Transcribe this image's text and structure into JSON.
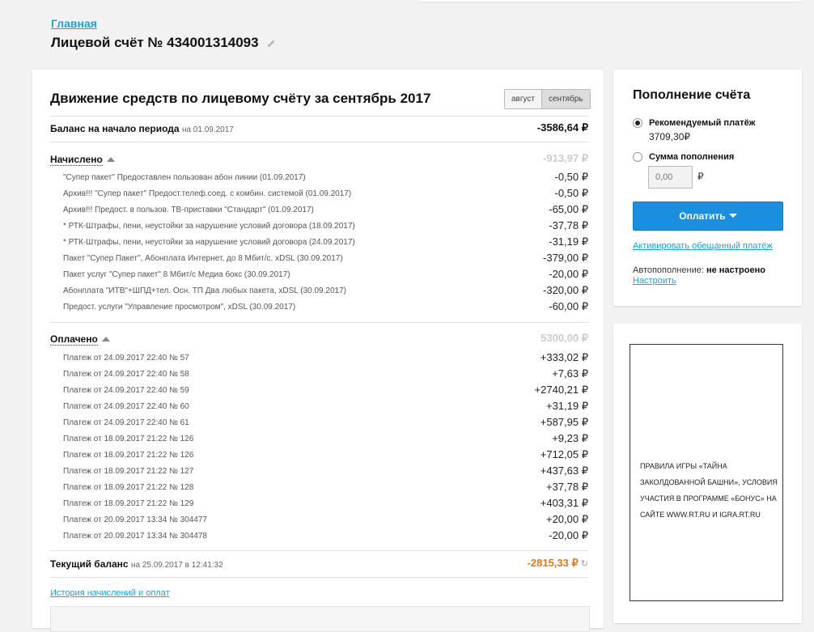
{
  "breadcrumb": "Главная",
  "page_title": "Лицевой счёт № 434001314093",
  "statement": {
    "title": "Движение средств по лицевому счёту за сентябрь 2017",
    "months": [
      {
        "label": "август",
        "active": false
      },
      {
        "label": "сентябрь",
        "active": true
      }
    ],
    "opening_balance": {
      "label": "Баланс на начало периода",
      "date_text": "на 01.09.2017",
      "amount": "-3586,64 ₽"
    },
    "charged": {
      "label": "Начислено",
      "total": "-913,97 ₽",
      "items": [
        {
          "desc": "\"Супер пакет\" Предоставлен пользован абон линии (01.09.2017)",
          "amount": "-0,50 ₽"
        },
        {
          "desc": "Архив!!! \"Супер пакет\" Предост.телеф.соед. с комбин. системой (01.09.2017)",
          "amount": "-0,50 ₽"
        },
        {
          "desc": "Архив!!! Предост. в пользов. ТВ-приставки \"Стандарт\" (01.09.2017)",
          "amount": "-65,00 ₽"
        },
        {
          "desc": "* РТК-Штрафы, пени, неустойки за нарушение условий договора (18.09.2017)",
          "amount": "-37,78 ₽"
        },
        {
          "desc": "* РТК-Штрафы, пени, неустойки за нарушение условий договора (24.09.2017)",
          "amount": "-31,19 ₽"
        },
        {
          "desc": "Пакет \"Супер Пакет\", Абонплата Интернет, до 8 Мбит/с, xDSL (30.09.2017)",
          "amount": "-379,00 ₽"
        },
        {
          "desc": "Пакет услуг \"Супер пакет\" 8 Мбит/с Медиа бокс (30.09.2017)",
          "amount": "-20,00 ₽"
        },
        {
          "desc": "Абонплата \"ИТВ\"+ШПД+тел. Осн. ТП Два любых пакета, xDSL (30.09.2017)",
          "amount": "-320,00 ₽"
        },
        {
          "desc": "Предост. услуги \"Управление просмотром\", xDSL (30.09.2017)",
          "amount": "-60,00 ₽"
        }
      ]
    },
    "paid": {
      "label": "Оплачено",
      "total": "5300,00 ₽",
      "items": [
        {
          "desc": "Платеж от 24.09.2017 22:40 № 57",
          "amount": "+333,02 ₽"
        },
        {
          "desc": "Платеж от 24.09.2017 22:40 № 58",
          "amount": "+7,63 ₽"
        },
        {
          "desc": "Платеж от 24.09.2017 22:40 № 59",
          "amount": "+2740,21 ₽"
        },
        {
          "desc": "Платеж от 24.09.2017 22:40 № 60",
          "amount": "+31,19 ₽"
        },
        {
          "desc": "Платеж от 24.09.2017 22:40 № 61",
          "amount": "+587,95 ₽"
        },
        {
          "desc": "Платеж от 18.09.2017 21:22 № 126",
          "amount": "+9,23 ₽"
        },
        {
          "desc": "Платеж от 18.09.2017 21:22 № 126",
          "amount": "+712,05 ₽"
        },
        {
          "desc": "Платеж от 18.09.2017 21:22 № 127",
          "amount": "+437,63 ₽"
        },
        {
          "desc": "Платеж от 18.09.2017 21:22 № 128",
          "amount": "+37,78 ₽"
        },
        {
          "desc": "Платеж от 18.09.2017 21:22 № 129",
          "amount": "+403,31 ₽"
        },
        {
          "desc": "Платеж от 20.09.2017 13:34 № 304477",
          "amount": "+20,00 ₽"
        },
        {
          "desc": "Платеж от 20.09.2017 13:34 № 304478",
          "amount": "-20,00 ₽"
        }
      ]
    },
    "current_balance": {
      "label": "Текущий баланс",
      "date_text": "на 25.09.2017 в 12:41:32",
      "amount": "-2815,33 ₽"
    },
    "history_link": "История начислений и оплат"
  },
  "topup": {
    "title": "Пополнение счёта",
    "recommended_label": "Рекомендуемый платёж",
    "recommended_amount": "3709,30₽",
    "custom_label": "Сумма пополнения",
    "amount_placeholder": "0,00",
    "currency": "₽",
    "pay_button": "Оплатить",
    "promise_link": "Активировать обещанный платёж",
    "autopay_label": "Автопополнение:",
    "autopay_status": "не настроено",
    "setup_link": "Настроить"
  },
  "promo": {
    "text": "ПРАВИЛА ИГРЫ «ТАЙНА ЗАКОЛДОВАННОЙ БАШНИ», УСЛОВИЯ УЧАСТИЯ В ПРОГРАММЕ «БОНУС» НА САЙТЕ WWW.RT.RU И IGRA.RT.RU"
  },
  "colors": {
    "link": "#1aa5d9",
    "pay_button": "#1a8fe0",
    "negative_balance": "#e07a18"
  }
}
